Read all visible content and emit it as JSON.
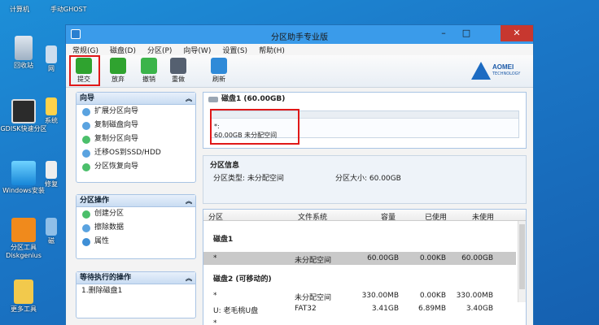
{
  "desktop": {
    "top_labels": [
      "计算机",
      "手动GHOST"
    ],
    "icons": [
      "回收站",
      "GDISK快速分区",
      "Windows安装",
      "分区工具Diskgenius",
      "更多工具"
    ],
    "partial_icons": [
      "网",
      "系统",
      "修复",
      "磁",
      "盘"
    ]
  },
  "window": {
    "title": "分区助手专业版",
    "controls": {
      "minimize": "–",
      "maximize": "□",
      "close": "✕"
    }
  },
  "menu": [
    "常规(G)",
    "磁盘(D)",
    "分区(P)",
    "向导(W)",
    "设置(S)",
    "帮助(H)"
  ],
  "toolbar": {
    "submit": "提交",
    "discard": "放弃",
    "undo": "撤销",
    "redo": "重做",
    "refresh": "刷新"
  },
  "logo": {
    "brand": "AOMEI",
    "sub": "TECHNOLOGY"
  },
  "wizard_panel": {
    "title": "向导",
    "items": [
      "扩展分区向导",
      "复制磁盘向导",
      "复制分区向导",
      "迁移OS到SSD/HDD",
      "分区恢复向导"
    ]
  },
  "ops_panel": {
    "title": "分区操作",
    "items": [
      "创建分区",
      "擦除数据",
      "属性"
    ]
  },
  "pending_panel": {
    "title": "等待执行的操作",
    "items": [
      "1.删除磁盘1"
    ]
  },
  "disk_map": {
    "header": "磁盘1 (60.00GB)",
    "partition_name": "*:",
    "partition_desc": "60.00GB 未分配空间"
  },
  "partition_info": {
    "title": "分区信息",
    "type": "分区类型: 未分配空间",
    "size": "分区大小: 60.00GB"
  },
  "table": {
    "columns": [
      "分区",
      "文件系统",
      "容量",
      "已使用",
      "未使用"
    ],
    "disk1_label": "磁盘1",
    "disk1_rows": [
      {
        "part": "*",
        "fs": "未分配空间",
        "cap": "60.00GB",
        "used": "0.00KB",
        "free": "60.00GB"
      }
    ],
    "disk2_label": "磁盘2 (可移动的)",
    "disk2_rows": [
      {
        "part": "*",
        "fs": "未分配空间",
        "cap": "330.00MB",
        "used": "0.00KB",
        "free": "330.00MB"
      },
      {
        "part": "U: 老毛桃U盘",
        "fs": "FAT32",
        "cap": "3.41GB",
        "used": "6.89MB",
        "free": "3.40GB"
      },
      {
        "part": "*",
        "fs": "",
        "cap": "",
        "used": "",
        "free": ""
      }
    ]
  },
  "colors": {
    "titlebar": "#3a9bea",
    "close": "#c7372f",
    "highlight": "#e01818",
    "accent": "#1c6bc2"
  }
}
